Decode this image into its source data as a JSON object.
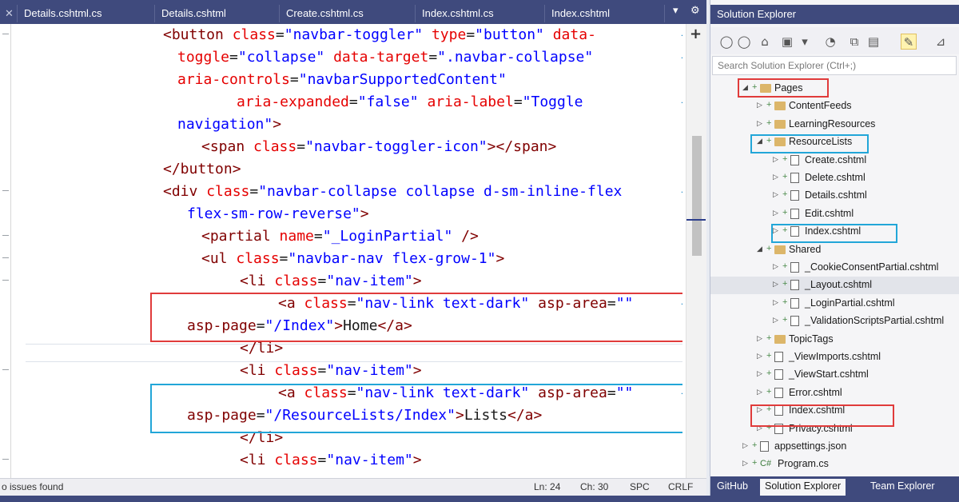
{
  "editor": {
    "tabs": [
      {
        "label": "Details.cshtml.cs"
      },
      {
        "label": "Details.cshtml"
      },
      {
        "label": "Create.cshtml.cs"
      },
      {
        "label": "Index.cshtml.cs"
      },
      {
        "label": "Index.cshtml"
      }
    ],
    "tab_close_glyph": "✕",
    "tab_menu_glyph": "▾",
    "tab_settings_glyph": "⚙",
    "lines": [
      [
        {
          "t": "tg",
          "s": "<button "
        },
        {
          "t": "at",
          "s": "class"
        },
        {
          "t": "tx",
          "s": "="
        },
        {
          "t": "vl",
          "s": "\"navbar-toggler\""
        },
        {
          "t": "tx",
          "s": " "
        },
        {
          "t": "at",
          "s": "type"
        },
        {
          "t": "tx",
          "s": "="
        },
        {
          "t": "vl",
          "s": "\"button\""
        },
        {
          "t": "tx",
          "s": " "
        },
        {
          "t": "at",
          "s": "data-"
        }
      ],
      [
        {
          "t": "at",
          "s": "toggle"
        },
        {
          "t": "tx",
          "s": "="
        },
        {
          "t": "vl",
          "s": "\"collapse\""
        },
        {
          "t": "tx",
          "s": " "
        },
        {
          "t": "at",
          "s": "data-target"
        },
        {
          "t": "tx",
          "s": "="
        },
        {
          "t": "vl",
          "s": "\".navbar-collapse\""
        }
      ],
      [
        {
          "t": "at",
          "s": "aria-controls"
        },
        {
          "t": "tx",
          "s": "="
        },
        {
          "t": "vl",
          "s": "\"navbarSupportedContent\""
        }
      ],
      [
        {
          "t": "at",
          "s": "aria-expanded"
        },
        {
          "t": "tx",
          "s": "="
        },
        {
          "t": "vl",
          "s": "\"false\""
        },
        {
          "t": "tx",
          "s": " "
        },
        {
          "t": "at",
          "s": "aria-label"
        },
        {
          "t": "tx",
          "s": "="
        },
        {
          "t": "vl",
          "s": "\"Toggle"
        }
      ],
      [
        {
          "t": "vl",
          "s": "navigation\""
        },
        {
          "t": "tg",
          "s": ">"
        }
      ],
      [
        {
          "t": "tg",
          "s": "<span "
        },
        {
          "t": "at",
          "s": "class"
        },
        {
          "t": "tx",
          "s": "="
        },
        {
          "t": "vl",
          "s": "\"navbar-toggler-icon\""
        },
        {
          "t": "tg",
          "s": "></span>"
        }
      ],
      [
        {
          "t": "tg",
          "s": "</button>"
        }
      ],
      [
        {
          "t": "tg",
          "s": "<div "
        },
        {
          "t": "at",
          "s": "class"
        },
        {
          "t": "tx",
          "s": "="
        },
        {
          "t": "vl",
          "s": "\"navbar-collapse collapse d-sm-inline-flex"
        }
      ],
      [
        {
          "t": "vl",
          "s": "flex-sm-row-reverse\""
        },
        {
          "t": "tg",
          "s": ">"
        }
      ],
      [
        {
          "t": "tg",
          "s": "<partial "
        },
        {
          "t": "at",
          "s": "name"
        },
        {
          "t": "tx",
          "s": "="
        },
        {
          "t": "vl",
          "s": "\"_LoginPartial\""
        },
        {
          "t": "tx",
          "s": " "
        },
        {
          "t": "tg",
          "s": "/>"
        }
      ],
      [
        {
          "t": "tg",
          "s": "<ul "
        },
        {
          "t": "at",
          "s": "class"
        },
        {
          "t": "tx",
          "s": "="
        },
        {
          "t": "vl",
          "s": "\"navbar-nav flex-grow-1\""
        },
        {
          "t": "tg",
          "s": ">"
        }
      ],
      [
        {
          "t": "tg",
          "s": "<li "
        },
        {
          "t": "at",
          "s": "class"
        },
        {
          "t": "tx",
          "s": "="
        },
        {
          "t": "vl",
          "s": "\"nav-item\""
        },
        {
          "t": "tg",
          "s": ">"
        }
      ],
      [
        {
          "t": "tg",
          "s": "<a "
        },
        {
          "t": "at",
          "s": "class"
        },
        {
          "t": "tx",
          "s": "="
        },
        {
          "t": "vl",
          "s": "\"nav-link text-dark\""
        },
        {
          "t": "tx",
          "s": " "
        },
        {
          "t": "tg",
          "s": "asp-area"
        },
        {
          "t": "tx",
          "s": "="
        },
        {
          "t": "vl",
          "s": "\"\""
        }
      ],
      [
        {
          "t": "tg",
          "s": "asp-page"
        },
        {
          "t": "tx",
          "s": "="
        },
        {
          "t": "vl",
          "s": "\"/Index\""
        },
        {
          "t": "tg",
          "s": ">"
        },
        {
          "t": "tx",
          "s": "Home"
        },
        {
          "t": "tg",
          "s": "</a>"
        }
      ],
      [
        {
          "t": "tg",
          "s": "</li>"
        }
      ],
      [
        {
          "t": "tg",
          "s": "<li "
        },
        {
          "t": "at",
          "s": "class"
        },
        {
          "t": "tx",
          "s": "="
        },
        {
          "t": "vl",
          "s": "\"nav-item\""
        },
        {
          "t": "tg",
          "s": ">"
        }
      ],
      [
        {
          "t": "tg",
          "s": "<a "
        },
        {
          "t": "at",
          "s": "class"
        },
        {
          "t": "tx",
          "s": "="
        },
        {
          "t": "vl",
          "s": "\"nav-link text-dark\""
        },
        {
          "t": "tx",
          "s": " "
        },
        {
          "t": "tg",
          "s": "asp-area"
        },
        {
          "t": "tx",
          "s": "="
        },
        {
          "t": "vl",
          "s": "\"\""
        }
      ],
      [
        {
          "t": "tg",
          "s": "asp-page"
        },
        {
          "t": "tx",
          "s": "="
        },
        {
          "t": "vl",
          "s": "\"/ResourceLists/Index\""
        },
        {
          "t": "tg",
          "s": ">"
        },
        {
          "t": "tx",
          "s": "Lists"
        },
        {
          "t": "tg",
          "s": "</a>"
        }
      ],
      [
        {
          "t": "tg",
          "s": "</li>"
        }
      ],
      [
        {
          "t": "tg",
          "s": "<li "
        },
        {
          "t": "at",
          "s": "class"
        },
        {
          "t": "tx",
          "s": "="
        },
        {
          "t": "vl",
          "s": "\"nav-item\""
        },
        {
          "t": "tg",
          "s": ">"
        }
      ]
    ],
    "wrap_glyph": "⇥",
    "scroll_plus": "+",
    "colors": {
      "tag": "#800000",
      "attribute": "#e50000",
      "value": "#0000ff",
      "highlight_red": "#e03b3b",
      "highlight_blue": "#22a6d8"
    }
  },
  "status": {
    "issues": "o issues found",
    "line": "Ln: 24",
    "col": "Ch: 30",
    "spc": "SPC",
    "eol": "CRLF"
  },
  "solution_explorer": {
    "title": "Solution Explorer",
    "toolbar_icons": [
      "back-icon",
      "forward-icon",
      "home-icon",
      "sync-icon",
      "dropdown-icon",
      "history-icon",
      "collapse-icon",
      "properties-icon",
      "preview-icon",
      "pin-icon"
    ],
    "search_placeholder": "Search Solution Explorer (Ctrl+;)",
    "tree": [
      {
        "label": "Pages",
        "type": "folder",
        "expanded": true
      },
      {
        "label": "ContentFeeds",
        "type": "folder",
        "expanded": false
      },
      {
        "label": "LearningResources",
        "type": "folder",
        "expanded": false
      },
      {
        "label": "ResourceLists",
        "type": "folder",
        "expanded": true
      },
      {
        "label": "Create.cshtml",
        "type": "file"
      },
      {
        "label": "Delete.cshtml",
        "type": "file"
      },
      {
        "label": "Details.cshtml",
        "type": "file"
      },
      {
        "label": "Edit.cshtml",
        "type": "file"
      },
      {
        "label": "Index.cshtml",
        "type": "file"
      },
      {
        "label": "Shared",
        "type": "folder",
        "expanded": true
      },
      {
        "label": "_CookieConsentPartial.cshtml",
        "type": "file"
      },
      {
        "label": "_Layout.cshtml",
        "type": "file",
        "selected": true
      },
      {
        "label": "_LoginPartial.cshtml",
        "type": "file"
      },
      {
        "label": "_ValidationScriptsPartial.cshtml",
        "type": "file"
      },
      {
        "label": "TopicTags",
        "type": "folder",
        "expanded": false
      },
      {
        "label": "_ViewImports.cshtml",
        "type": "file"
      },
      {
        "label": "_ViewStart.cshtml",
        "type": "file"
      },
      {
        "label": "Error.cshtml",
        "type": "file"
      },
      {
        "label": "Index.cshtml",
        "type": "file"
      },
      {
        "label": "Privacy.cshtml",
        "type": "file"
      },
      {
        "label": "appsettings.json",
        "type": "json"
      },
      {
        "label": "Program.cs",
        "type": "cs",
        "badge": "C#"
      }
    ],
    "tabs": [
      {
        "label": "GitHub"
      },
      {
        "label": "Solution Explorer",
        "active": true
      },
      {
        "label": "Team Explorer"
      }
    ]
  }
}
